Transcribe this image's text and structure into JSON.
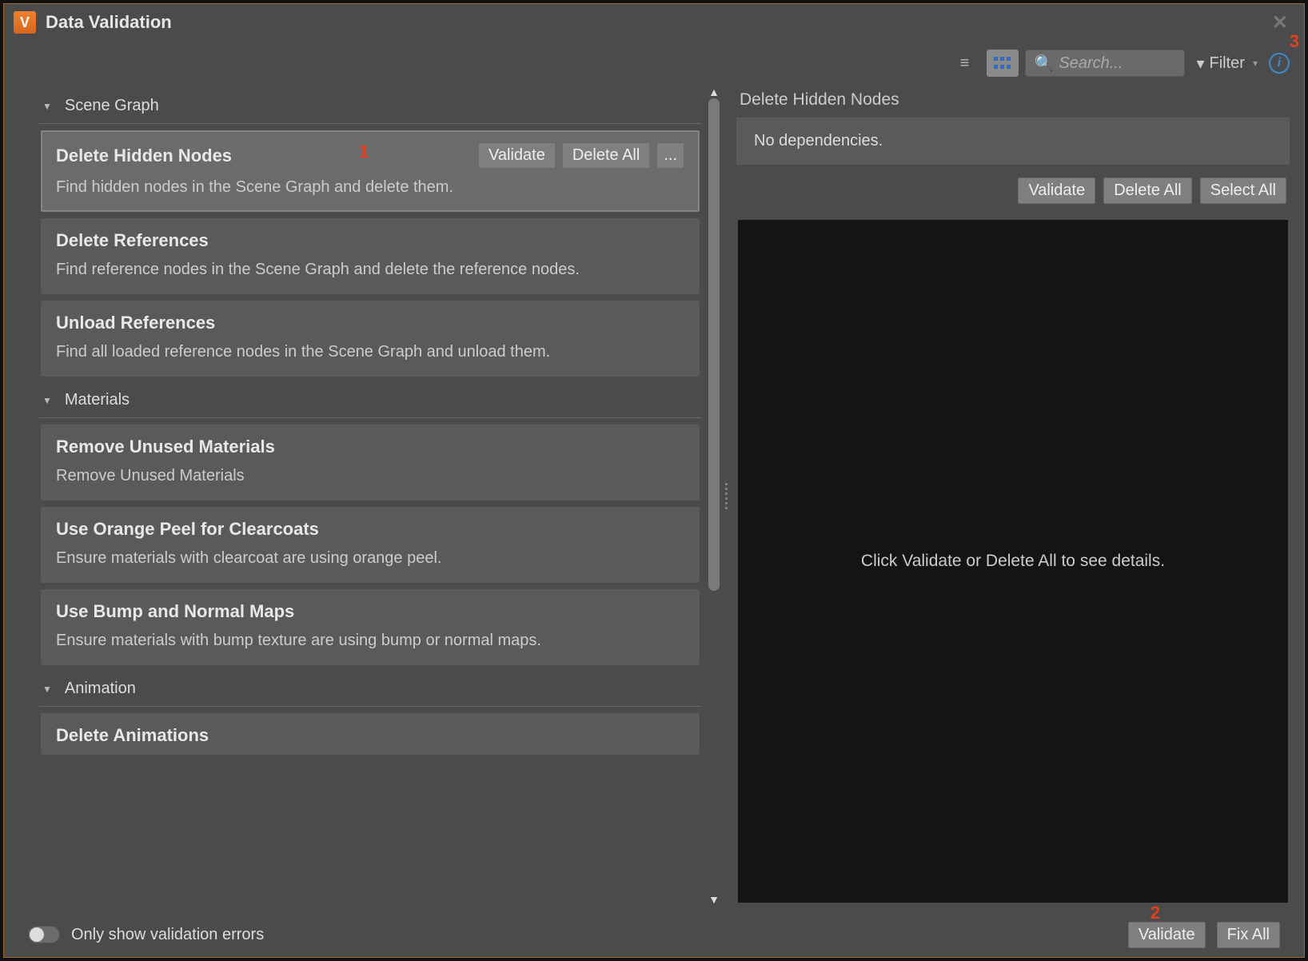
{
  "window": {
    "title": "Data Validation"
  },
  "annotations": {
    "one": "1",
    "two": "2",
    "three": "3"
  },
  "toolbar": {
    "search_placeholder": "Search...",
    "filter_label": "Filter"
  },
  "sections": [
    {
      "title": "Scene Graph",
      "items": [
        {
          "title": "Delete Hidden Nodes",
          "desc": "Find hidden nodes in the Scene Graph and delete them.",
          "selected": true,
          "actions": {
            "validate": "Validate",
            "fix": "Delete All",
            "more": "..."
          }
        },
        {
          "title": "Delete References",
          "desc": "Find reference nodes in the Scene Graph and delete the reference nodes."
        },
        {
          "title": "Unload References",
          "desc": "Find all loaded reference nodes in the Scene Graph and unload them."
        }
      ]
    },
    {
      "title": "Materials",
      "items": [
        {
          "title": "Remove Unused Materials",
          "desc": "Remove Unused Materials"
        },
        {
          "title": "Use Orange Peel for Clearcoats",
          "desc": "Ensure materials with clearcoat are using orange peel."
        },
        {
          "title": "Use Bump and Normal Maps",
          "desc": "Ensure materials with bump texture are using bump or normal maps."
        }
      ]
    },
    {
      "title": "Animation",
      "items": [
        {
          "title": "Delete Animations",
          "desc": ""
        }
      ]
    }
  ],
  "detail": {
    "header": "Delete Hidden Nodes",
    "deps": "No dependencies.",
    "actions": {
      "validate": "Validate",
      "fix": "Delete All",
      "select": "Select All"
    },
    "placeholder": "Click Validate or Delete All to see details."
  },
  "footer": {
    "toggle_label": "Only show validation errors",
    "validate": "Validate",
    "fix": "Fix All"
  }
}
